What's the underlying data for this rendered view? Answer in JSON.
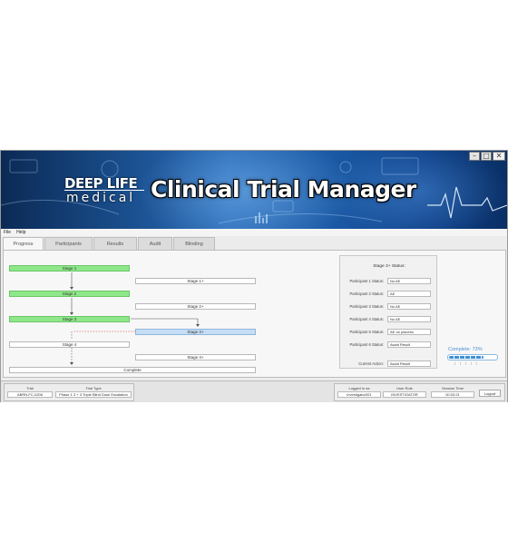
{
  "window": {
    "logo_line1": "DEEP LIFE",
    "logo_line2": "medical",
    "app_title": "Clinical Trial Manager",
    "controls": [
      "minimize-icon",
      "maximize-icon",
      "close-icon"
    ]
  },
  "menu": {
    "items": [
      "File",
      "Help"
    ]
  },
  "tabs": [
    {
      "label": "Progress",
      "active": true
    },
    {
      "label": "Participants",
      "active": false
    },
    {
      "label": "Results",
      "active": false
    },
    {
      "label": "Audit",
      "active": false
    },
    {
      "label": "Blinding",
      "active": false
    }
  ],
  "stages": {
    "s1": "Stage 1",
    "s1p": "Stage 1+",
    "s2": "Stage 2",
    "s2p": "Stage 2+",
    "s3": "Stage 3",
    "s3p": "Stage 3+",
    "s4": "Stage 4",
    "s4p": "Stage 4+",
    "complete": "Complete"
  },
  "status": {
    "title": "Stage 3+ Status:",
    "rows": [
      {
        "label": "Participant 1 Status:",
        "value": "No AE"
      },
      {
        "label": "Participant 2 Status:",
        "value": "AE"
      },
      {
        "label": "Participant 3 Status:",
        "value": "No AE"
      },
      {
        "label": "Participant 4 Status:",
        "value": "No AE"
      },
      {
        "label": "Participant 5 Status:",
        "value": "AE on placebo"
      },
      {
        "label": "Participant 6 Status:",
        "value": "Await Result"
      }
    ],
    "current_action_label": "Current Action:",
    "current_action_value": "Await Result"
  },
  "progress": {
    "label": "Complete: 73%",
    "value": 0.73
  },
  "footer": {
    "trial_header": "Trial",
    "trial_value": "ABRN-FC-0206",
    "type_header": "Trial Type",
    "type_value": "Phase 1 3 + 3 Triple Blind Dose Escalation",
    "user_header": "Logged in as",
    "user_value": "investigator001",
    "role_header": "User Role",
    "role_value": "INVESTIGATOR",
    "session_header": "Session Time",
    "session_value": "00:03:21",
    "logout_label": "Logout"
  },
  "colors": {
    "stage_done": "#8ee88a",
    "stage_active": "#c6def5",
    "accent": "#4a90d0"
  }
}
